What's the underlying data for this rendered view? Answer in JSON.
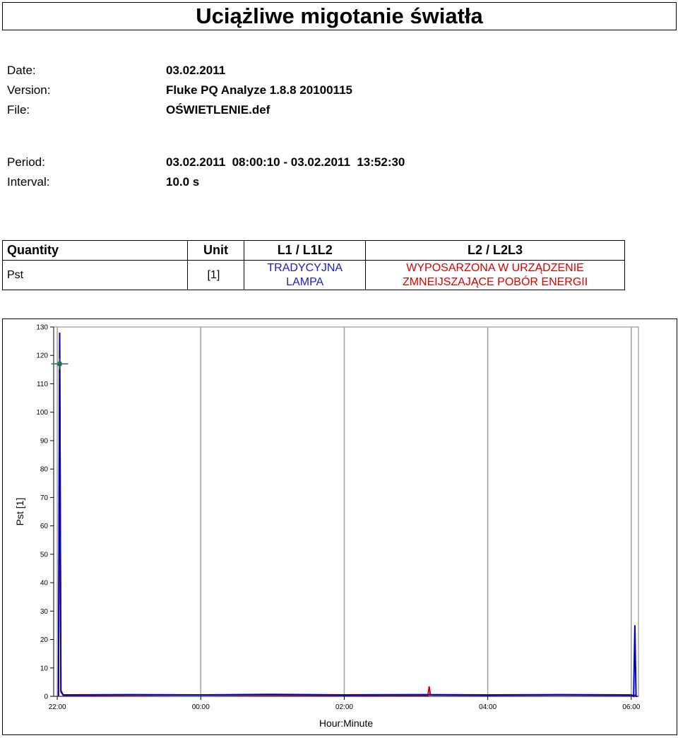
{
  "title": "Uciążliwe migotanie światła",
  "meta": {
    "date_label": "Date:",
    "date_value": "03.02.2011",
    "version_label": "Version:",
    "version_value": "Fluke PQ Analyze 1.8.8 20100115",
    "file_label": "File:",
    "file_value": "OŚWIETLENIE.def",
    "period_label": "Period:",
    "period_value": "03.02.2011  08:00:10 - 03.02.2011  13:52:30",
    "interval_label": "Interval:",
    "interval_value": "10.0 s"
  },
  "table": {
    "headers": [
      "Quantity",
      "Unit",
      "L1 / L1L2",
      "L2 / L2L3"
    ],
    "row": {
      "quantity": "Pst",
      "unit": "[1]",
      "l1_line1": "TRADYCYJNA",
      "l1_line2": "LAMPA",
      "l2_line1": "WYPOSARZONA W URZĄDZENIE",
      "l2_line2": "ZMNEIJSZAJĄCE POBÓR ENERGII"
    }
  },
  "colors": {
    "l1": "#0000c0",
    "l2": "#e00000",
    "grid": "#a0a0a0"
  },
  "chart_data": {
    "type": "line",
    "xlabel": "Hour:Minute",
    "ylabel": "Pst [1]",
    "ylim": [
      0,
      130
    ],
    "yticks": [
      0,
      10,
      20,
      30,
      40,
      50,
      60,
      70,
      80,
      90,
      100,
      110,
      120,
      130
    ],
    "xticks": [
      "22:00",
      "00:00",
      "02:00",
      "04:00",
      "06:00"
    ],
    "x_hours_range": [
      21.95,
      30.1
    ],
    "grid": true,
    "marker": {
      "x": "22:02",
      "y": 117
    },
    "series": [
      {
        "name": "L1 / L1L2",
        "points": [
          [
            "22:01",
            0
          ],
          [
            "22:02",
            128
          ],
          [
            "22:03",
            2
          ],
          [
            "22:05",
            0.5
          ],
          [
            "23:00",
            0.6
          ],
          [
            "00:00",
            0.5
          ],
          [
            "01:00",
            0.7
          ],
          [
            "02:00",
            0.5
          ],
          [
            "03:00",
            0.6
          ],
          [
            "04:00",
            0.5
          ],
          [
            "05:00",
            0.6
          ],
          [
            "06:00",
            0.5
          ],
          [
            "06:02",
            0
          ],
          [
            "06:03",
            25
          ],
          [
            "06:04",
            0
          ],
          [
            "06:05",
            0
          ]
        ]
      },
      {
        "name": "L2 / L2L3",
        "points": [
          [
            "22:01",
            0
          ],
          [
            "22:02",
            127
          ],
          [
            "22:03",
            1.5
          ],
          [
            "22:05",
            0.4
          ],
          [
            "00:00",
            0.5
          ],
          [
            "02:00",
            0.4
          ],
          [
            "03:10",
            0.4
          ],
          [
            "03:11",
            3.5
          ],
          [
            "03:12",
            0.5
          ],
          [
            "04:00",
            0.4
          ],
          [
            "05:00",
            0.5
          ],
          [
            "06:00",
            0.4
          ],
          [
            "06:04",
            0.4
          ]
        ]
      }
    ]
  }
}
